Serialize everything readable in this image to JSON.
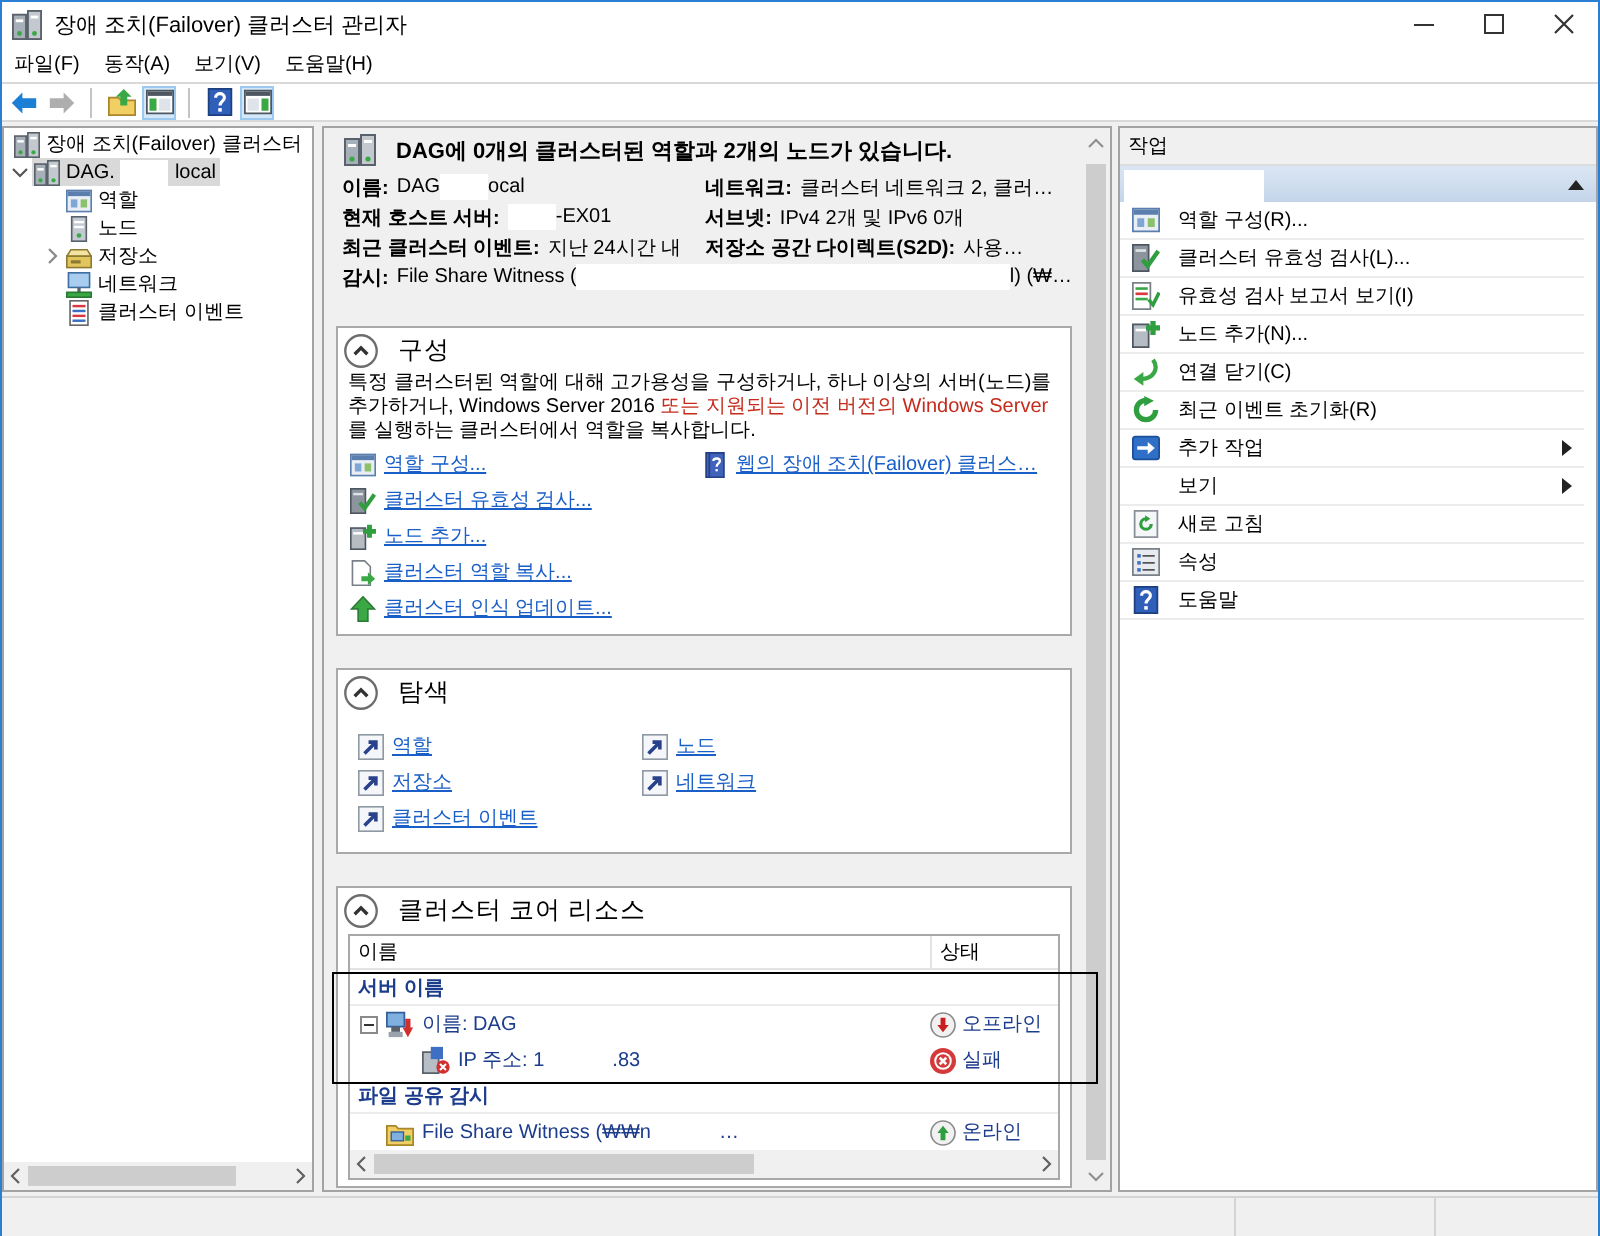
{
  "window": {
    "title": "장애 조치(Failover) 클러스터 관리자"
  },
  "menu": [
    {
      "label": "파일(F)"
    },
    {
      "label": "동작(A)"
    },
    {
      "label": "보기(V)"
    },
    {
      "label": "도움말(H)"
    }
  ],
  "toolbar": {
    "groups": [
      {
        "buttons": [
          {
            "kind": "back",
            "disabled": false,
            "on": false
          },
          {
            "kind": "forward",
            "disabled": true,
            "on": false
          }
        ]
      },
      {
        "buttons": [
          {
            "kind": "up",
            "disabled": false,
            "on": false
          },
          {
            "kind": "console-tree",
            "disabled": false,
            "on": true
          }
        ]
      },
      {
        "buttons": [
          {
            "kind": "help",
            "disabled": false,
            "on": false
          },
          {
            "kind": "action-pane",
            "disabled": false,
            "on": true
          }
        ]
      }
    ]
  },
  "tree": {
    "items": [
      {
        "kind": "cluster-manager",
        "label": "장애 조치(Failover) 클러스터",
        "selected": false,
        "children": [
          {
            "kind": "cluster",
            "label": [
              {
                "kind": "text",
                "text": "DAG."
              },
              {
                "kind": "redaction"
              },
              {
                "kind": "text",
                "text": "local"
              }
            ],
            "selected": true,
            "expanded": true,
            "children": [
              {
                "kind": "roles",
                "label": "역할",
                "selected": false
              },
              {
                "kind": "nodes",
                "label": "노드",
                "selected": false
              },
              {
                "kind": "storage",
                "label": "저장소",
                "selected": false,
                "expanded": false
              },
              {
                "kind": "networks",
                "label": "네트워크",
                "selected": false
              },
              {
                "kind": "events",
                "label": "클러스터 이벤트",
                "selected": false
              }
            ]
          }
        ]
      }
    ]
  },
  "summary": {
    "title": "DAG에 0개의 클러스터된 역할과 2개의 노드가 있습니다.",
    "rows": [
      {
        "fields": [
          {
            "label": "이름:",
            "value": [
              {
                "kind": "text",
                "text": "DAG"
              },
              {
                "kind": "redaction"
              },
              {
                "kind": "text",
                "text": "ocal"
              }
            ]
          },
          {
            "label": "네트워크:",
            "value": "클러스터 네트워크 2, 클러…"
          }
        ]
      },
      {
        "fields": [
          {
            "label": "현재 호스트 서버:",
            "value": [
              {
                "kind": "redaction"
              },
              {
                "kind": "text",
                "text": "-EX01"
              }
            ]
          },
          {
            "label": "서브넷:",
            "value": "IPv4 2개 및 IPv6 0개"
          }
        ]
      },
      {
        "fields": [
          {
            "label": "최근 클러스터 이벤트:",
            "value": "지난 24시간 내"
          },
          {
            "label": "저장소 공간 다이렉트(S2D):",
            "value": "사용…"
          }
        ]
      },
      {
        "fields": [
          {
            "label": "감시:",
            "value": [
              {
                "kind": "text",
                "text": "File Share Witness ("
              },
              {
                "kind": "redaction"
              },
              {
                "kind": "text",
                "text": "l) (₩…"
              }
            ]
          }
        ]
      }
    ]
  },
  "sections": [
    {
      "kind": "configure",
      "title": "구성",
      "expanded": true,
      "description": [
        {
          "text": "특정 클러스터된 역할에 대해 고가용성을 구성하거나, 하나 이상의 서버(노드)를 추가하거나, Windows Server 2016 ",
          "emphasis": false
        },
        {
          "text": "또는 지원되는 이전 버전의 Windows Server",
          "emphasis": true
        },
        {
          "text": "를 실행하는 클러스터에서 역할을 복사합니다.",
          "emphasis": false
        }
      ],
      "link_columns": [
        {
          "links": [
            {
              "kind": "configure-role",
              "label": "역할 구성..."
            },
            {
              "kind": "validate",
              "label": "클러스터 유효성 검사..."
            },
            {
              "kind": "add-node",
              "label": "노드 추가..."
            },
            {
              "kind": "copy-roles",
              "label": "클러스터 역할 복사..."
            },
            {
              "kind": "cluster-update",
              "label": "클러스터 인식 업데이트..."
            }
          ]
        },
        {
          "links": [
            {
              "kind": "web-help",
              "label": "웹의 장애 조치(Failover) 클러스…"
            }
          ]
        }
      ]
    },
    {
      "kind": "navigate",
      "title": "탐색",
      "expanded": true,
      "links": [
        {
          "kind": "shortcut",
          "label": "역할"
        },
        {
          "kind": "shortcut",
          "label": "노드"
        },
        {
          "kind": "shortcut",
          "label": "저장소"
        },
        {
          "kind": "shortcut",
          "label": "네트워크"
        },
        {
          "kind": "shortcut",
          "label": "클러스터 이벤트"
        }
      ]
    },
    {
      "kind": "resources",
      "title": "클러스터 코어 리소스",
      "expanded": true,
      "table": {
        "columns": [
          {
            "label": "이름"
          },
          {
            "label": "상태"
          }
        ],
        "groups": [
          {
            "label": "서버 이름",
            "outlined": true,
            "rows": [
              {
                "kind": "network-name",
                "name": "이름: DAG",
                "status": {
                  "kind": "offline",
                  "label": "오프라인"
                },
                "expanded": true,
                "children": [
                  {
                    "kind": "ip-address",
                    "name": [
                      {
                        "kind": "text",
                        "text": "IP 주소: 1"
                      },
                      {
                        "kind": "redaction"
                      },
                      {
                        "kind": "text",
                        "text": ".83"
                      }
                    ],
                    "status": {
                      "kind": "failed",
                      "label": "실패"
                    }
                  }
                ]
              }
            ]
          },
          {
            "label": "파일 공유 감시",
            "outlined": false,
            "rows": [
              {
                "kind": "file-share-witness",
                "name": [
                  {
                    "kind": "text",
                    "text": "File Share Witness (₩₩n"
                  },
                  {
                    "kind": "redaction"
                  },
                  {
                    "kind": "text",
                    "text": "…"
                  }
                ],
                "status": {
                  "kind": "online",
                  "label": "온라인"
                }
              }
            ]
          }
        ]
      }
    }
  ],
  "actions": {
    "title": "작업",
    "group": {
      "expanded": true,
      "title": [
        {
          "kind": "redaction"
        }
      ]
    },
    "items": [
      {
        "kind": "configure-role",
        "label": "역할 구성(R)...",
        "submenu": false
      },
      {
        "kind": "validate",
        "label": "클러스터 유효성 검사(L)...",
        "submenu": false
      },
      {
        "kind": "report",
        "label": "유효성 검사 보고서 보기(I)",
        "submenu": false
      },
      {
        "kind": "add-node",
        "label": "노드 추가(N)...",
        "submenu": false
      },
      {
        "kind": "close-connection",
        "label": "연결 닫기(C)",
        "submenu": false
      },
      {
        "kind": "reset-events",
        "label": "최근 이벤트 초기화(R)",
        "submenu": false
      },
      {
        "kind": "more-actions",
        "label": "추가 작업",
        "submenu": true
      },
      {
        "kind": "view",
        "label": "보기",
        "submenu": true
      },
      {
        "kind": "refresh",
        "label": "새로 고침",
        "submenu": false
      },
      {
        "kind": "properties",
        "label": "속성",
        "submenu": false
      },
      {
        "kind": "help",
        "label": "도움말",
        "submenu": false
      }
    ]
  }
}
